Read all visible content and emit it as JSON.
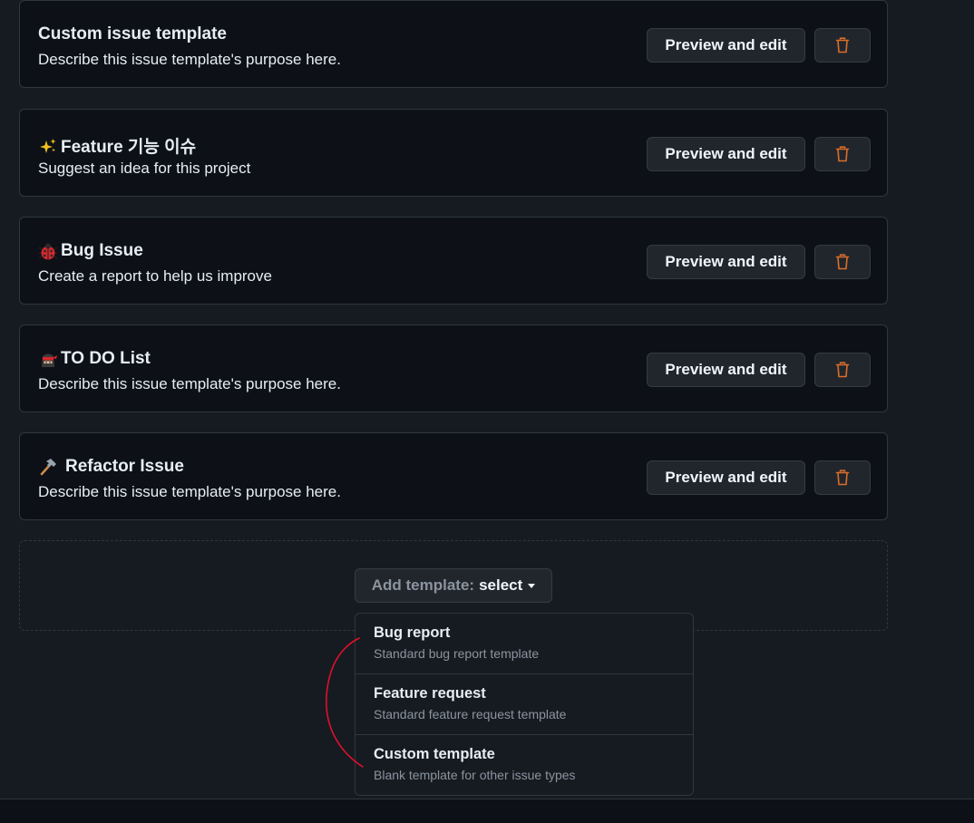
{
  "templates": [
    {
      "emoji": "",
      "title": "Custom issue template",
      "description": "Describe this issue template's purpose here."
    },
    {
      "emoji": "sparkles-icon",
      "title": "Feature 기능 이슈",
      "description": "Suggest an idea for this project"
    },
    {
      "emoji": "ladybug-icon",
      "title": "Bug Issue",
      "description": "Create a report to help us improve"
    },
    {
      "emoji": "ninja-icon",
      "title": "TO DO List",
      "description": "Describe this issue template's purpose here."
    },
    {
      "emoji": "hammer-icon",
      "title": "Refactor Issue",
      "description": "Describe this issue template's purpose here."
    }
  ],
  "buttons": {
    "preview_label": "Preview and edit",
    "delete_icon": "trash-icon"
  },
  "add_template": {
    "prefix": "Add template:",
    "value": "select"
  },
  "menu": {
    "items": [
      {
        "title": "Bug report",
        "description": "Standard bug report template"
      },
      {
        "title": "Feature request",
        "description": "Standard feature request template"
      },
      {
        "title": "Custom template",
        "description": "Blank template for other issue types"
      }
    ]
  },
  "colors": {
    "background": "#161b22",
    "card": "#0d1117",
    "border": "#30363d",
    "button": "#21262d",
    "danger_icon": "#db6d28",
    "annotation": "#e0102a"
  }
}
